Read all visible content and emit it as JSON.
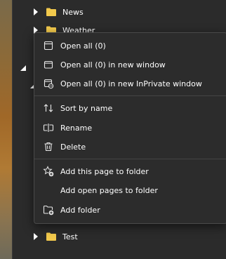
{
  "tree": {
    "items": [
      {
        "label": "News",
        "icon": "folder-icon"
      },
      {
        "label": "Weather",
        "icon": "folder-icon"
      },
      {
        "label": "Test",
        "icon": "folder-icon"
      }
    ]
  },
  "context_menu": {
    "items": [
      {
        "label": "Open all (0)",
        "icon": "tab-icon"
      },
      {
        "label": "Open all (0) in new window",
        "icon": "window-icon"
      },
      {
        "label": "Open all (0) in new InPrivate window",
        "icon": "inprivate-window-icon"
      },
      {
        "label": "Sort by name",
        "icon": "sort-icon"
      },
      {
        "label": "Rename",
        "icon": "rename-icon"
      },
      {
        "label": "Delete",
        "icon": "trash-icon"
      },
      {
        "label": "Add this page to folder",
        "icon": "star-add-icon"
      },
      {
        "label": "Add open pages to folder",
        "icon": ""
      },
      {
        "label": "Add folder",
        "icon": "folder-add-icon"
      }
    ]
  },
  "colors": {
    "folder": "#f2c94c",
    "menu_bg": "#2c2c2c",
    "text": "#ffffff"
  }
}
